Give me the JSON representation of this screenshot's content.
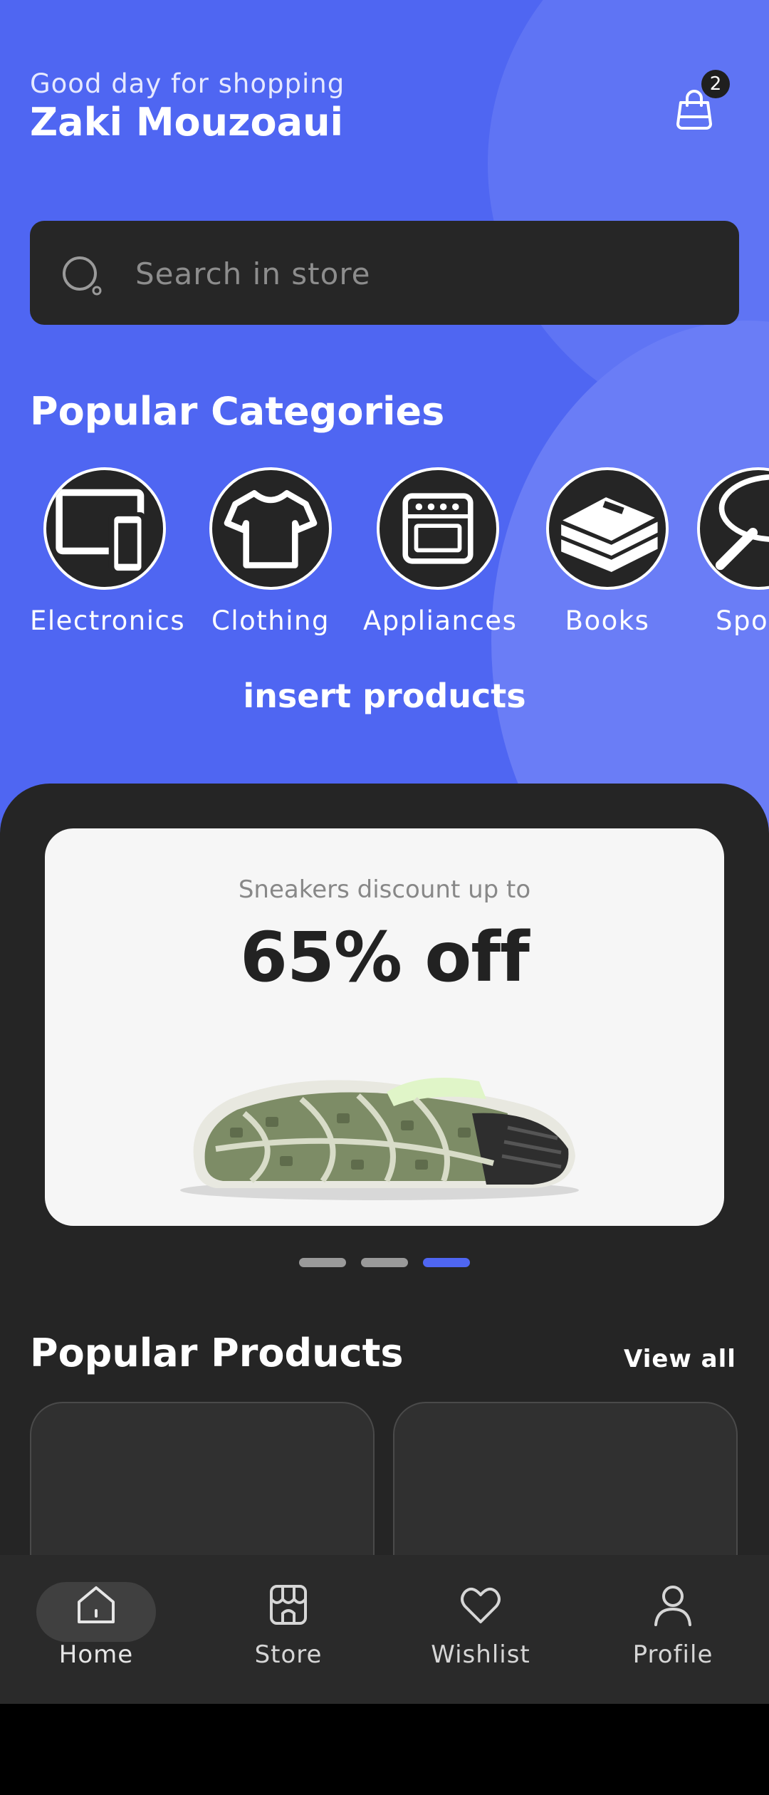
{
  "header": {
    "greeting": "Good day for shopping",
    "user_name": "Zaki Mouzoaui",
    "cart_count": "2"
  },
  "search": {
    "placeholder": "Search in store"
  },
  "categories": {
    "title": "Popular Categories",
    "items": [
      {
        "label": "Electronics",
        "icon": "electronics-icon"
      },
      {
        "label": "Clothing",
        "icon": "tshirt-icon"
      },
      {
        "label": "Appliances",
        "icon": "oven-icon"
      },
      {
        "label": "Books",
        "icon": "books-icon"
      },
      {
        "label": "Spo",
        "icon": "sports-icon"
      }
    ]
  },
  "insert_text": "insert products",
  "banner": {
    "subtitle": "Sneakers discount up to",
    "title": "65% off",
    "image": "sneaker-sole-image",
    "page_count": 3,
    "active_page": 3
  },
  "products": {
    "title": "Popular Products",
    "view_all": "View all"
  },
  "nav": {
    "items": [
      {
        "label": "Home",
        "icon": "home-icon",
        "active": true
      },
      {
        "label": "Store",
        "icon": "store-icon",
        "active": false
      },
      {
        "label": "Wishlist",
        "icon": "heart-icon",
        "active": false
      },
      {
        "label": "Profile",
        "icon": "user-icon",
        "active": false
      }
    ]
  },
  "colors": {
    "primary": "#4f66f2",
    "dark": "#252525",
    "banner_bg": "#f6f6f6"
  }
}
